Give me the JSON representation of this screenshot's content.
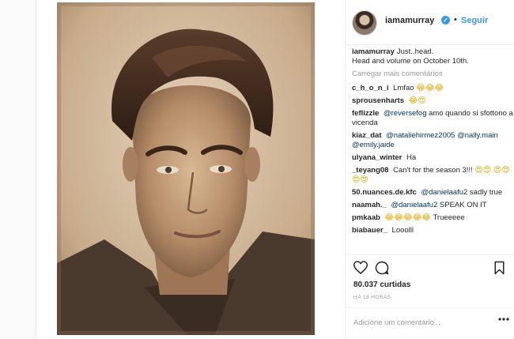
{
  "post": {
    "author": "iamamurray",
    "follow_label": "Seguir",
    "separator": "•",
    "caption": {
      "username": "iamamurray",
      "line1": "Just..head.",
      "line2": "Head and volume on October 10th."
    },
    "load_more_label": "Carregar mais comentários",
    "comments": [
      {
        "user": "c_h_o_n_i",
        "text": "Lmfao",
        "emojis": "😂😂😂"
      },
      {
        "user": "sprousenharts",
        "text": "",
        "emojis": "😂😍"
      },
      {
        "user": "feflizzle",
        "mention": "@reversefog",
        "text": "amo quando si sfottono a vicenda"
      },
      {
        "user": "kiaz_dat",
        "mention": "@nataliehirmez2005",
        "mention2": "@nally.main",
        "mention3": "@emily.jaide"
      },
      {
        "user": "ulyana_winter",
        "text": "Ha"
      },
      {
        "user": "_teyang08",
        "text": "Can't for the season 3!!!",
        "emojis": "😍😍",
        "emojis2": "😍😍😍😍"
      },
      {
        "user": "50.nuances.de.kfc",
        "mention": "@danielaafu2",
        "text": "sadly true"
      },
      {
        "user": "naamah._",
        "mention": "@danielaafu2",
        "text": "SPEAK ON IT"
      },
      {
        "user": "pmkaab",
        "emojis": "😂😂😂😂😂",
        "text": "Trueeeee"
      },
      {
        "user": "biabauer_",
        "text": "Looolll"
      }
    ],
    "likes": "80.037 curtidas",
    "timestamp": "HÁ 18 HORAS",
    "add_comment_placeholder": "Adicione um comentário..."
  },
  "icons": {
    "verified": "verified-badge-icon",
    "like": "heart-icon",
    "comment": "comment-icon",
    "save": "bookmark-icon",
    "more": "more-options-icon"
  },
  "colors": {
    "link_blue": "#3897f0",
    "mention_blue": "#003569",
    "muted_gray": "#999999",
    "text": "#262626",
    "border": "#efefef"
  }
}
